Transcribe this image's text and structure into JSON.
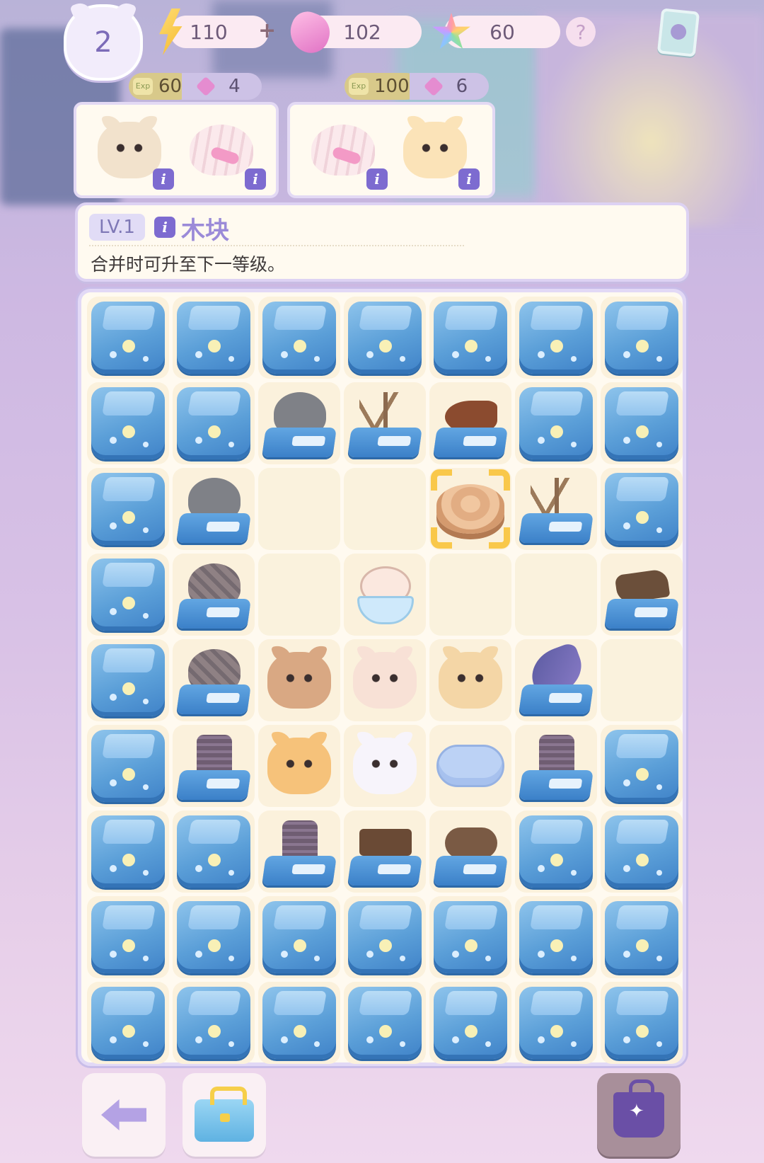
{
  "hud": {
    "player_level": "2",
    "energy": "110",
    "energy_plus": "+",
    "gems": "102",
    "stars": "60",
    "help": "?"
  },
  "orders": [
    {
      "exp": "60",
      "gems": "4",
      "exp_tag": "Exp",
      "items": [
        "siamese-cat",
        "seashell"
      ]
    },
    {
      "exp": "100",
      "gems": "6",
      "exp_tag": "Exp",
      "items": [
        "seashell",
        "calico-cat"
      ]
    }
  ],
  "info_panel": {
    "level": "LV.1",
    "name": "木块",
    "description": "合并时可升至下一等级。"
  },
  "board": {
    "rows": [
      [
        "ice",
        "ice",
        "ice",
        "ice",
        "ice",
        "ice",
        "ice"
      ],
      [
        "ice",
        "ice",
        "box-stone",
        "box-coral",
        "box-fish",
        "ice",
        "ice"
      ],
      [
        "ice",
        "box-stone",
        "empty",
        "empty",
        "wood-selected",
        "box-coral",
        "ice"
      ],
      [
        "ice",
        "box-yarn",
        "empty",
        "hamster-bowl",
        "empty",
        "empty",
        "box-branches"
      ],
      [
        "ice",
        "box-yarn",
        "brown-cat",
        "hamster-bib",
        "hamster-book",
        "box-feather",
        ""
      ],
      [
        "ice",
        "box-thread",
        "orange-cat",
        "white-unicorn-cat",
        "pet-bed",
        "box-thread",
        "ice"
      ],
      [
        "ice",
        "ice",
        "box-thread",
        "box-plank",
        "box-log",
        "ice",
        "ice"
      ],
      [
        "ice",
        "ice",
        "ice",
        "ice",
        "ice",
        "ice",
        "ice"
      ],
      [
        "ice",
        "ice",
        "ice",
        "ice",
        "ice",
        "ice",
        "ice"
      ]
    ]
  },
  "bottom": {
    "back": "back-arrow-icon",
    "inventory": "toolbox-icon",
    "shop": "shopping-cart-icon"
  }
}
